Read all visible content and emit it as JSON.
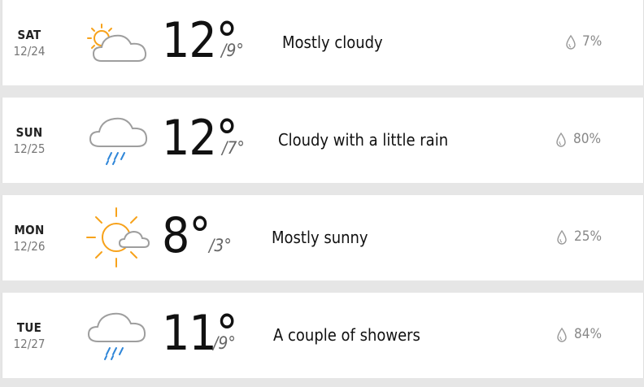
{
  "days": [
    {
      "dow": "SAT",
      "date": "12/24",
      "icon": "sun-partly-cloudy-icon",
      "high": "12°",
      "low": "/9°",
      "phrase": "Mostly cloudy",
      "precip": "7%"
    },
    {
      "dow": "SUN",
      "date": "12/25",
      "icon": "cloud-rain-icon",
      "high": "12°",
      "low": "/7°",
      "phrase": "Cloudy with a little rain",
      "precip": "80%"
    },
    {
      "dow": "MON",
      "date": "12/26",
      "icon": "sun-small-cloud-icon",
      "high": "8°",
      "low": "/3°",
      "phrase": "Mostly sunny",
      "precip": "25%"
    },
    {
      "dow": "TUE",
      "date": "12/27",
      "icon": "cloud-rain-icon",
      "high": "11°",
      "low": "/9°",
      "phrase": "A couple of showers",
      "precip": "84%"
    }
  ],
  "colors": {
    "sun": "#f7a21b",
    "cloud": "#9e9e9e",
    "rain": "#2f86d8",
    "separator": "#e6e6e6"
  }
}
